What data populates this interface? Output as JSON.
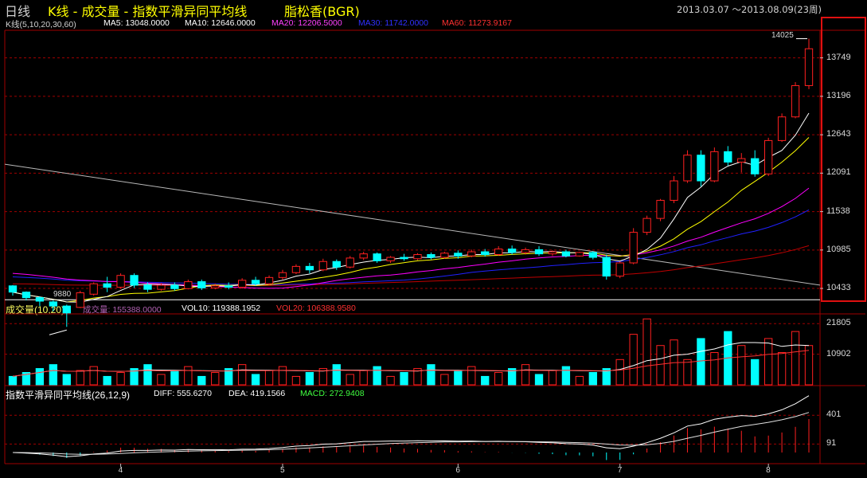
{
  "header": {
    "period": "日线",
    "title": "K线 - 成交量 - 指数平滑异同平均线",
    "stock": "脂松香(BGR)",
    "range": "2013.03.07 ～2013.08.09(23周)"
  },
  "kline": {
    "label": "K线(5,10,20,30,60)",
    "ma5": "MA5: 13048.0000",
    "ma10": "MA10: 12646.0000",
    "ma20": "MA20: 12206.5000",
    "ma30": "MA30: 11742.0000",
    "ma60": "MA60: 11273.9167",
    "high_mark": "14025",
    "low_mark": "9880"
  },
  "volume": {
    "label": "成交量(10,20)",
    "vol": "成交量: 155388.0000",
    "vol10": "VOL10: 119388.1952",
    "vol20": "VOL20: 106388.9580"
  },
  "macd": {
    "label": "指数平滑异同平均线(26,12,9)",
    "diff": "DIFF: 555.6270",
    "dea": "DEA: 419.1566",
    "macd": "MACD: 272.9408"
  },
  "colors": {
    "up": "#ff2020",
    "down": "#00ffff",
    "ma5": "#ffffff",
    "ma10": "#ffff00",
    "ma20": "#ff00ff",
    "ma30": "#2020ff",
    "ma60": "#c00000",
    "grid": "#a00000"
  },
  "chart_data": [
    {
      "type": "candlestick",
      "ylim": [
        10250,
        14100
      ],
      "y_ticks": [
        10433,
        10985,
        11538,
        12091,
        12643,
        13196,
        13749
      ],
      "x_ticks": [
        "4",
        "5",
        "6",
        "7",
        "8"
      ],
      "markers": {
        "high": 14025,
        "low": 9880
      },
      "candles": [
        {
          "o": 10470,
          "h": 10480,
          "c": 10380,
          "l": 10330
        },
        {
          "o": 10380,
          "h": 10390,
          "c": 10300,
          "l": 10260
        },
        {
          "o": 10300,
          "h": 10320,
          "c": 10250,
          "l": 10180
        },
        {
          "o": 10240,
          "h": 10260,
          "c": 10180,
          "l": 10100
        },
        {
          "o": 10180,
          "h": 10200,
          "c": 10080,
          "l": 9880
        },
        {
          "o": 10160,
          "h": 10400,
          "c": 10370,
          "l": 10150
        },
        {
          "o": 10350,
          "h": 10520,
          "c": 10500,
          "l": 10330
        },
        {
          "o": 10500,
          "h": 10600,
          "c": 10450,
          "l": 10380
        },
        {
          "o": 10450,
          "h": 10650,
          "c": 10620,
          "l": 10430
        },
        {
          "o": 10620,
          "h": 10650,
          "c": 10480,
          "l": 10440
        },
        {
          "o": 10480,
          "h": 10520,
          "c": 10420,
          "l": 10380
        },
        {
          "o": 10420,
          "h": 10510,
          "c": 10480,
          "l": 10400
        },
        {
          "o": 10480,
          "h": 10520,
          "c": 10430,
          "l": 10400
        },
        {
          "o": 10430,
          "h": 10560,
          "c": 10530,
          "l": 10420
        },
        {
          "o": 10530,
          "h": 10560,
          "c": 10440,
          "l": 10410
        },
        {
          "o": 10440,
          "h": 10500,
          "c": 10470,
          "l": 10420
        },
        {
          "o": 10470,
          "h": 10520,
          "c": 10450,
          "l": 10420
        },
        {
          "o": 10450,
          "h": 10580,
          "c": 10550,
          "l": 10430
        },
        {
          "o": 10550,
          "h": 10600,
          "c": 10500,
          "l": 10470
        },
        {
          "o": 10500,
          "h": 10620,
          "c": 10590,
          "l": 10480
        },
        {
          "o": 10590,
          "h": 10700,
          "c": 10660,
          "l": 10560
        },
        {
          "o": 10660,
          "h": 10780,
          "c": 10750,
          "l": 10640
        },
        {
          "o": 10750,
          "h": 10800,
          "c": 10700,
          "l": 10650
        },
        {
          "o": 10700,
          "h": 10860,
          "c": 10820,
          "l": 10680
        },
        {
          "o": 10820,
          "h": 10850,
          "c": 10740,
          "l": 10700
        },
        {
          "o": 10740,
          "h": 10900,
          "c": 10870,
          "l": 10720
        },
        {
          "o": 10870,
          "h": 10960,
          "c": 10930,
          "l": 10840
        },
        {
          "o": 10930,
          "h": 10950,
          "c": 10830,
          "l": 10800
        },
        {
          "o": 10830,
          "h": 10900,
          "c": 10880,
          "l": 10800
        },
        {
          "o": 10880,
          "h": 10930,
          "c": 10860,
          "l": 10830
        },
        {
          "o": 10860,
          "h": 10940,
          "c": 10920,
          "l": 10840
        },
        {
          "o": 10920,
          "h": 10950,
          "c": 10880,
          "l": 10850
        },
        {
          "o": 10880,
          "h": 10960,
          "c": 10940,
          "l": 10860
        },
        {
          "o": 10940,
          "h": 10980,
          "c": 10900,
          "l": 10860
        },
        {
          "o": 10900,
          "h": 10990,
          "c": 10960,
          "l": 10880
        },
        {
          "o": 10960,
          "h": 11000,
          "c": 10920,
          "l": 10890
        },
        {
          "o": 10920,
          "h": 11040,
          "c": 11000,
          "l": 10900
        },
        {
          "o": 11000,
          "h": 11050,
          "c": 10950,
          "l": 10920
        },
        {
          "o": 10950,
          "h": 11020,
          "c": 10990,
          "l": 10920
        },
        {
          "o": 10990,
          "h": 11040,
          "c": 10930,
          "l": 10900
        },
        {
          "o": 10930,
          "h": 10980,
          "c": 10960,
          "l": 10900
        },
        {
          "o": 10960,
          "h": 10990,
          "c": 10900,
          "l": 10880
        },
        {
          "o": 10900,
          "h": 10960,
          "c": 10950,
          "l": 10890
        },
        {
          "o": 10950,
          "h": 10970,
          "c": 10880,
          "l": 10850
        },
        {
          "o": 10880,
          "h": 10920,
          "c": 10610,
          "l": 10560
        },
        {
          "o": 10610,
          "h": 10820,
          "c": 10800,
          "l": 10580
        },
        {
          "o": 10800,
          "h": 11300,
          "c": 11240,
          "l": 10780
        },
        {
          "o": 11240,
          "h": 11480,
          "c": 11440,
          "l": 11200
        },
        {
          "o": 11440,
          "h": 11720,
          "c": 11700,
          "l": 11400
        },
        {
          "o": 11700,
          "h": 12050,
          "c": 11980,
          "l": 11660
        },
        {
          "o": 11980,
          "h": 12420,
          "c": 12350,
          "l": 11950
        },
        {
          "o": 12350,
          "h": 12420,
          "c": 11980,
          "l": 11900
        },
        {
          "o": 11980,
          "h": 12460,
          "c": 12400,
          "l": 11960
        },
        {
          "o": 12400,
          "h": 12480,
          "c": 12250,
          "l": 12200
        },
        {
          "o": 12250,
          "h": 12380,
          "c": 12300,
          "l": 12100
        },
        {
          "o": 12300,
          "h": 12420,
          "c": 12080,
          "l": 12040
        },
        {
          "o": 12080,
          "h": 12600,
          "c": 12560,
          "l": 12050
        },
        {
          "o": 12560,
          "h": 12950,
          "c": 12900,
          "l": 12540
        },
        {
          "o": 12900,
          "h": 13400,
          "c": 13350,
          "l": 12880
        },
        {
          "o": 13350,
          "h": 14025,
          "c": 13880,
          "l": 13300
        }
      ]
    },
    {
      "type": "bar",
      "name": "volume",
      "y_ticks": [
        10902,
        21805
      ],
      "ylim": [
        0,
        25000
      ]
    },
    {
      "type": "line",
      "name": "macd",
      "y_ticks": [
        91,
        401
      ],
      "ylim": [
        -120,
        600
      ]
    }
  ]
}
